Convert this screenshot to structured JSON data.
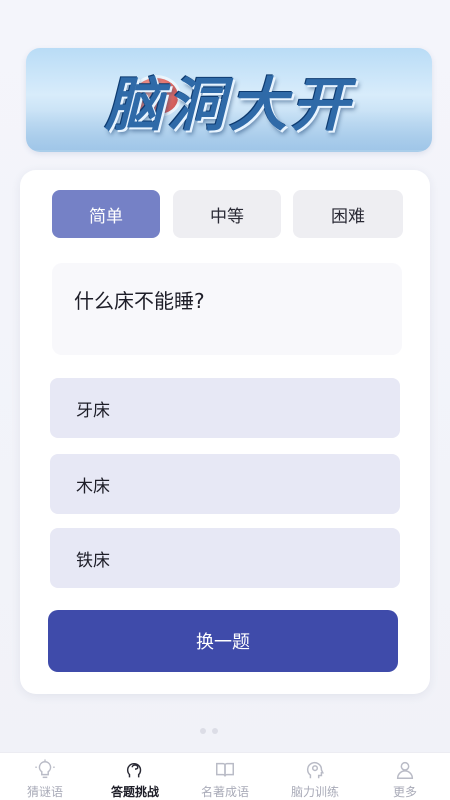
{
  "banner": {
    "title": "脑洞大开"
  },
  "difficulty_tabs": [
    {
      "label": "简单",
      "active": true
    },
    {
      "label": "中等",
      "active": false
    },
    {
      "label": "困难",
      "active": false
    }
  ],
  "question": {
    "text": "什么床不能睡?"
  },
  "options": [
    {
      "label": "牙床"
    },
    {
      "label": "木床"
    },
    {
      "label": "铁床"
    }
  ],
  "next_button": {
    "label": "换一题"
  },
  "bottom_nav": [
    {
      "label": "猜谜语",
      "icon": "lightbulb-icon",
      "active": false
    },
    {
      "label": "答题挑战",
      "icon": "brain-head-icon",
      "active": true
    },
    {
      "label": "名著成语",
      "icon": "book-icon",
      "active": false
    },
    {
      "label": "脑力训练",
      "icon": "head-profile-icon",
      "active": false
    },
    {
      "label": "更多",
      "icon": "user-icon",
      "active": false
    }
  ],
  "colors": {
    "accent": "#3f4baa",
    "active_tab": "#7581c6",
    "option_bg": "#e7e8f5"
  }
}
